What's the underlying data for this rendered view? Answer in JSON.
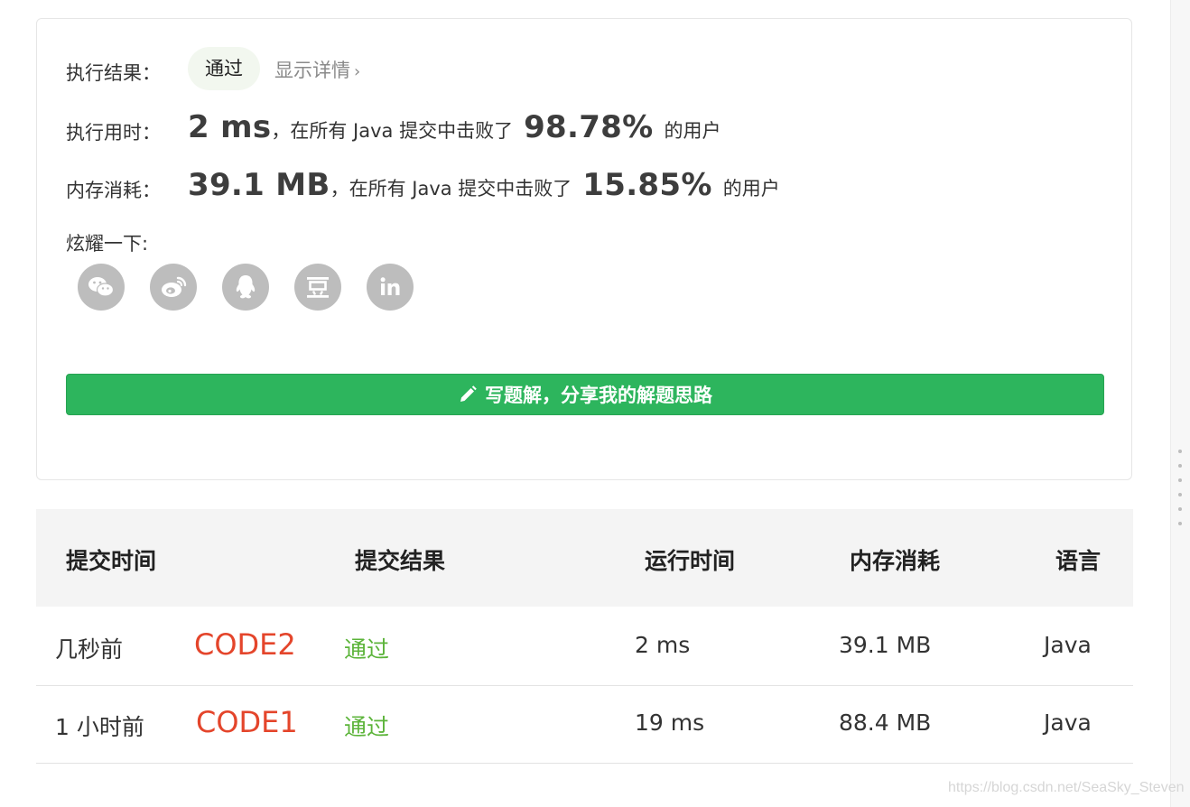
{
  "result": {
    "status_label": "执行结果：",
    "status_value": "通过",
    "details_link": "显示详情"
  },
  "runtime": {
    "label": "执行用时：",
    "value": "2 ms",
    "prefix": "，在所有 Java 提交中击败了",
    "percent": "98.78%",
    "suffix": "的用户"
  },
  "memory": {
    "label": "内存消耗：",
    "value": "39.1 MB",
    "prefix": "，在所有 Java 提交中击败了",
    "percent": "15.85%",
    "suffix": "的用户"
  },
  "share": {
    "label": "炫耀一下:",
    "icons": [
      "wechat-icon",
      "weibo-icon",
      "qq-icon",
      "douban-icon",
      "linkedin-icon"
    ]
  },
  "cta": {
    "label": "写题解，分享我的解题思路"
  },
  "table": {
    "headers": [
      "提交时间",
      "提交结果",
      "运行时间",
      "内存消耗",
      "语言"
    ],
    "rows": [
      {
        "time": "几秒前",
        "tag": "CODE2",
        "result": "通过",
        "runtime": "2 ms",
        "memory": "39.1 MB",
        "lang": "Java"
      },
      {
        "time": "1 小时前",
        "tag": "CODE1",
        "result": "通过",
        "runtime": "19 ms",
        "memory": "88.4 MB",
        "lang": "Java"
      }
    ]
  },
  "watermark": "https://blog.csdn.net/SeaSky_Steven",
  "colors": {
    "accent_green": "#2db55d",
    "pass_green": "#5cb43a",
    "annotation_red": "#e4452b",
    "icon_gray": "#bdbdbd"
  }
}
